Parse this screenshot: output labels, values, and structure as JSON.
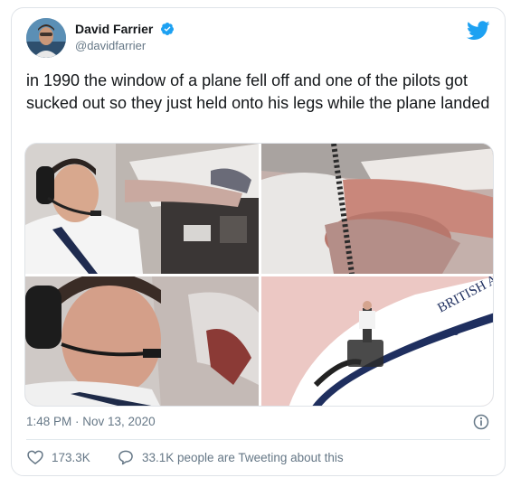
{
  "author": {
    "name": "David Farrier",
    "handle": "@davidfarrier",
    "verified": true
  },
  "tweet": {
    "text": "in 1990 the window of a plane fell off and one of the pilots got sucked out so they just held onto his legs while the plane landed"
  },
  "media": {
    "photos": [
      "pilot-in-cockpit-photo",
      "man-holding-legs-photo",
      "pilot-close-up-photo",
      "plane-illustration-photo"
    ],
    "plane_lettering": "BRITISH AI"
  },
  "meta": {
    "timestamp": "1:48 PM · Nov 13, 2020"
  },
  "actions": {
    "likes": "173.3K",
    "conversation": "33.1K people are Tweeting about this"
  },
  "colors": {
    "twitter_blue": "#1da1f2",
    "secondary_text": "#657786",
    "border": "#dfe3e8"
  }
}
